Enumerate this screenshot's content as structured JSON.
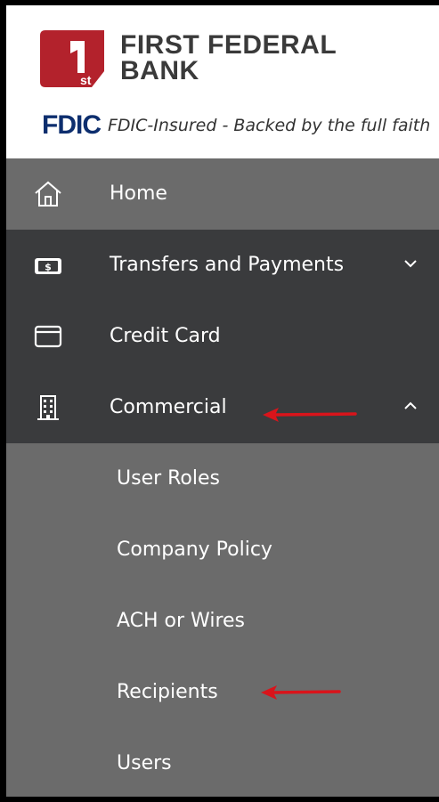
{
  "brand": {
    "name_line1": "FIRST FEDERAL",
    "name_line2": "BANK",
    "logo_suffix": "st",
    "fdic_logo": "FDIC",
    "fdic_text": "FDIC-Insured - Backed by the full faith",
    "colors": {
      "brand_red": "#b3222c",
      "fdic_blue": "#0d2e6e"
    }
  },
  "nav": {
    "items": [
      {
        "label": "Home",
        "icon": "home-icon",
        "active": true
      },
      {
        "label": "Transfers and Payments",
        "icon": "money-icon",
        "expanded": false
      },
      {
        "label": "Credit Card",
        "icon": "credit-card-icon"
      },
      {
        "label": "Commercial",
        "icon": "building-icon",
        "expanded": true
      }
    ],
    "commercial_sub_items": [
      {
        "label": "User Roles"
      },
      {
        "label": "Company Policy"
      },
      {
        "label": "ACH or Wires"
      },
      {
        "label": "Recipients"
      },
      {
        "label": "Users"
      }
    ]
  },
  "annotations": {
    "arrow_color": "#d9141b",
    "targets": [
      "Commercial",
      "Recipients"
    ]
  }
}
